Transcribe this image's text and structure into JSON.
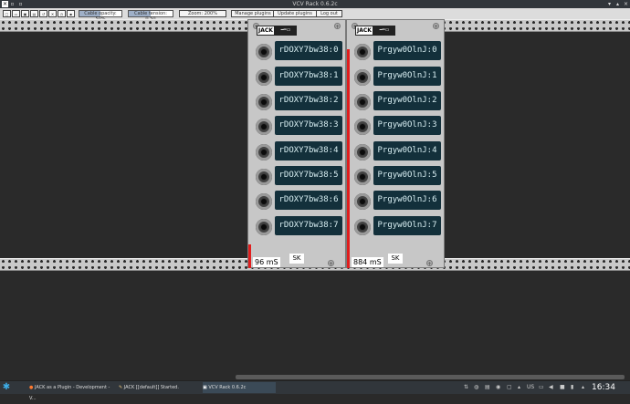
{
  "window": {
    "title": "VCV Rack 0.6.2c"
  },
  "toolbar": {
    "cable_opacity": {
      "label": "Cable opacity: 50%",
      "fraction": 0.5
    },
    "cable_tension": {
      "label": "Cable tension: 0.50",
      "fraction": 0.5
    },
    "zoom": {
      "label": "Zoom: 200%"
    },
    "manage_plugins": "Manage plugins",
    "update_plugins": "Update plugins",
    "log_out": "Log out"
  },
  "modules": [
    {
      "logo": "JACK",
      "ports": [
        "rDOXY7bw38:0",
        "rDOXY7bw38:1",
        "rDOXY7bw38:2",
        "rDOXY7bw38:3",
        "rDOXY7bw38:4",
        "rDOXY7bw38:5",
        "rDOXY7bw38:6",
        "rDOXY7bw38:7"
      ],
      "latency": "96 mS",
      "sk": "SK"
    },
    {
      "logo": "JACK",
      "ports": [
        "Prgyw0OlnJ:0",
        "Prgyw0OlnJ:1",
        "Prgyw0OlnJ:2",
        "Prgyw0OlnJ:3",
        "Prgyw0OlnJ:4",
        "Prgyw0OlnJ:5",
        "Prgyw0OlnJ:6",
        "Prgyw0OlnJ:7"
      ],
      "latency": "884 mS",
      "sk": "SK"
    }
  ],
  "taskbar": {
    "items": [
      "JACK as a Plugin - Development - V...",
      "JACK [[default]] Started.",
      "VCV Rack 0.6.2c"
    ],
    "locale": "US",
    "clock": "16:34"
  },
  "colors": {
    "label_bg": "#13303b",
    "meter": "#e11d1d",
    "panel": "#c7c7c7"
  }
}
